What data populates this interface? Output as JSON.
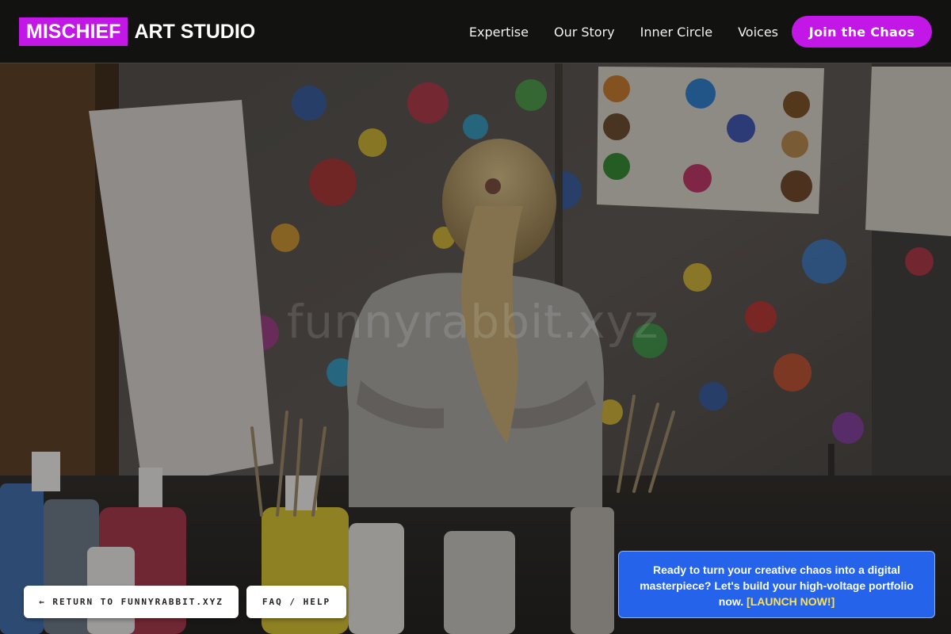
{
  "header": {
    "logo_mark": "MISCHIEF",
    "logo_rest": "ART STUDIO",
    "nav": [
      {
        "label": "Expertise"
      },
      {
        "label": "Our Story"
      },
      {
        "label": "Inner Circle"
      },
      {
        "label": "Voices"
      }
    ],
    "cta_label": "Join the Chaos"
  },
  "hero": {
    "watermark": "funnyrabbit.xyz"
  },
  "footer_buttons": {
    "return_label": "← RETURN TO FUNNYRABBIT.XYZ",
    "faq_label": "FAQ / HELP"
  },
  "promo": {
    "text": "Ready to turn your creative chaos into a digital masterpiece? Let's build your high-voltage portfolio now.",
    "link_label": "[LAUNCH NOW!]"
  },
  "colors": {
    "brand": "#c217e6",
    "promo_bg": "#2563eb",
    "promo_link": "#ffe14d",
    "header_bg": "#121212"
  }
}
